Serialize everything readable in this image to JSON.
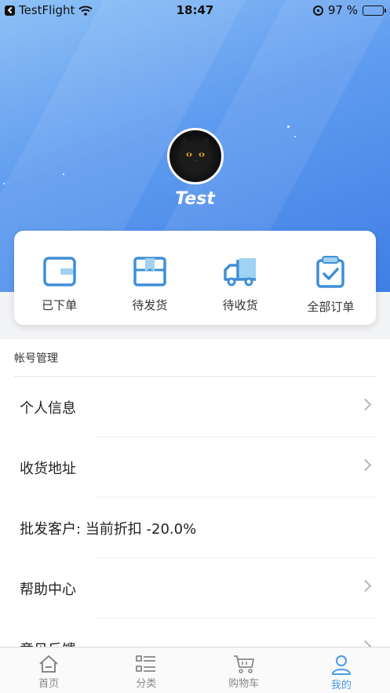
{
  "status_bar": {
    "app": "TestFlight",
    "time": "18:47",
    "battery": "97 %",
    "battery_level": 0.97
  },
  "profile": {
    "username": "Test"
  },
  "orders": [
    {
      "label": "已下单",
      "icon": "wallet-icon"
    },
    {
      "label": "待发货",
      "icon": "package-icon"
    },
    {
      "label": "待收货",
      "icon": "delivery-truck-icon"
    },
    {
      "label": "全部订单",
      "icon": "clipboard-check-icon"
    }
  ],
  "account": {
    "section_title": "帐号管理",
    "rows": [
      {
        "label": "个人信息",
        "chevron": true
      },
      {
        "label": "收货地址",
        "chevron": true
      },
      {
        "label": "批发客户: 当前折扣 -20.0%",
        "chevron": false
      },
      {
        "label": "帮助中心",
        "chevron": true
      },
      {
        "label": "意见反馈",
        "chevron": true
      }
    ]
  },
  "tabbar": {
    "tabs": [
      {
        "label": "首页",
        "icon": "home-icon",
        "active": false
      },
      {
        "label": "分类",
        "icon": "category-list-icon",
        "active": false
      },
      {
        "label": "购物车",
        "icon": "cart-icon",
        "active": false
      },
      {
        "label": "我的",
        "icon": "user-icon",
        "active": true
      }
    ]
  },
  "colors": {
    "accent": "#4a9be8",
    "header_start": "#8ec1f5",
    "header_end": "#3f7fe6"
  }
}
